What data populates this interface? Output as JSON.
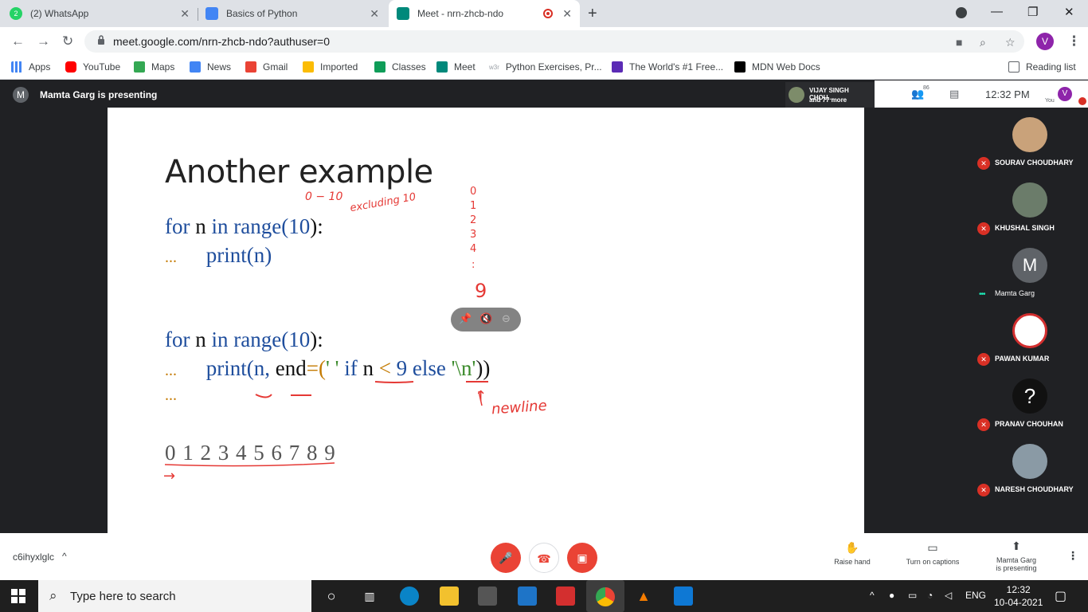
{
  "tabs": [
    {
      "label": "(2) WhatsApp",
      "favicon_color": "#25d366",
      "badge": "2"
    },
    {
      "label": "Basics of Python",
      "favicon_color": "#4285f4"
    },
    {
      "label": "Meet - nrn-zhcb-ndo",
      "favicon_color": "#00897b"
    }
  ],
  "address": {
    "url": "meet.google.com/nrn-zhcb-ndo?authuser=0",
    "profile_initial": "V"
  },
  "bookmarks": [
    {
      "label": "Apps",
      "icon": "apps-grid-icon",
      "color": "#4285f4"
    },
    {
      "label": "YouTube",
      "icon": "youtube-icon",
      "color": "#ff0000"
    },
    {
      "label": "Maps",
      "icon": "maps-icon",
      "color": "#34a853"
    },
    {
      "label": "News",
      "icon": "news-icon",
      "color": "#4285f4"
    },
    {
      "label": "Gmail",
      "icon": "gmail-icon",
      "color": "#ea4335"
    },
    {
      "label": "Imported",
      "icon": "folder-icon",
      "color": "#fbbc04"
    },
    {
      "label": "Classes",
      "icon": "classroom-icon",
      "color": "#0f9d58"
    },
    {
      "label": "Meet",
      "icon": "meet-icon",
      "color": "#00897b"
    },
    {
      "label": "Python Exercises, Pr...",
      "icon": "w3schools-icon",
      "color": "#9aa0a6",
      "prefix": "w3r"
    },
    {
      "label": "The World's #1 Free...",
      "icon": "codewithharry-icon",
      "color": "#5b2bb5"
    },
    {
      "label": "MDN Web Docs",
      "icon": "mdn-icon",
      "color": "#000000"
    }
  ],
  "reading_list": "Reading list",
  "meet": {
    "presenter_initial": "M",
    "presenting_text": "Mamta Garg is presenting",
    "active_speaker_line1": "VIJAY SINGH CHOU...",
    "active_speaker_line2": "and 77 more",
    "participant_count": "86",
    "time": "12:32  PM",
    "you_label": "You",
    "user_initial": "V",
    "meeting_code": "c6ihyxlglc",
    "raise_hand": "Raise hand",
    "captions": "Turn on captions",
    "presenting_line1": "Mamta Garg",
    "presenting_line2": "is presenting"
  },
  "slide": {
    "title": "Another example",
    "code1_l1": [
      "for",
      "n",
      "in",
      "range(",
      "10",
      "):"
    ],
    "code1_l2": [
      "...",
      "print(n)"
    ],
    "code2_l1": [
      "for",
      "n",
      "in",
      "range(",
      "10",
      "):"
    ],
    "code2_l2": [
      "...",
      "print(n,",
      "end",
      "=(",
      "' '",
      "if",
      "n",
      "<",
      "9",
      "else",
      "'\\n'",
      "))"
    ],
    "code2_l3": "...",
    "output": "0 1 2 3 4 5 6 7 8 9",
    "annotations": {
      "range_note": "0 − 10",
      "excluding": "excluding 10",
      "col_0": "0",
      "col_1": "1",
      "col_2": "2",
      "col_3": "3",
      "col_4": "4",
      "col_dots": ":",
      "col_9": "9",
      "arrow_up": "↑",
      "newline": "newline",
      "arrow_right": "→"
    }
  },
  "participants": [
    {
      "name": "SOURAV CHOUDHARY",
      "avatar_color": "#c9a27a",
      "muted": true
    },
    {
      "name": "KHUSHAL SINGH",
      "avatar_color": "#6b7c6a",
      "muted": true
    },
    {
      "name": "Mamta Garg",
      "avatar_color": "#5f6368",
      "initial": "M",
      "muted": false
    },
    {
      "name": "PAWAN KUMAR",
      "avatar_color": "#ffffff",
      "muted": true
    },
    {
      "name": "PRANAV CHOUHAN",
      "avatar_color": "#111111",
      "muted": true
    },
    {
      "name": "NARESH CHOUDHARY",
      "avatar_color": "#8a9aa5",
      "muted": true
    }
  ],
  "taskbar": {
    "search_placeholder": "Type here to search",
    "lang": "ENG",
    "time": "12:32",
    "date": "10-04-2021"
  }
}
